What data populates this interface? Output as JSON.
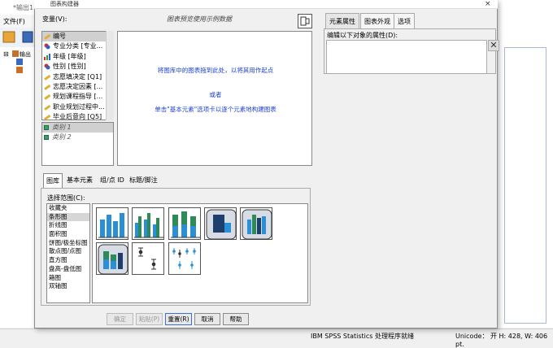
{
  "background": {
    "window_title": "*输出1",
    "menu_file": "文件(F)",
    "status_text": "IBM SPSS Statistics 处理程序就绪",
    "status_right": "Unicode： 开  H: 428, W: 406 pt."
  },
  "dialog": {
    "title": "图表构建器",
    "close_glyph": "×",
    "variables_label": "变量(V):",
    "preview_hint": "图表预览使用示例数据",
    "variables": [
      {
        "label": "编号",
        "icon": "scale-ruler-icon"
      },
      {
        "label": "专业分类 [专业...",
        "icon": "nominal-icon"
      },
      {
        "label": "年级 [年级]",
        "icon": "ordinal-bar-icon"
      },
      {
        "label": "性别 [性别]",
        "icon": "nominal-icon"
      },
      {
        "label": "志愿填决定 [Q1]",
        "icon": "scale-ruler-icon"
      },
      {
        "label": "志愿决定因素 [...",
        "icon": "scale-ruler-icon"
      },
      {
        "label": "规划课程指导 [...",
        "icon": "scale-ruler-icon"
      },
      {
        "label": "职业规划过程中...",
        "icon": "scale-ruler-icon"
      },
      {
        "label": "毕业后意向 [Q5]",
        "icon": "scale-ruler-icon"
      }
    ],
    "categories": [
      "类别 1",
      "类别 2"
    ],
    "canvas": {
      "line1": "将图库中的图表拖到此处，以将其用作起点",
      "or": "或者",
      "line2": "单击\"基本元素\"选项卡以逐个元素地构建图表"
    },
    "right_panel": {
      "tabs": [
        "元素属性",
        "图表外观",
        "选项"
      ],
      "edit_label": "编辑以下对象的属性(D):",
      "delete_glyph": "✕"
    },
    "gallery": {
      "tabs": [
        "图库",
        "基本元素",
        "组/点 ID",
        "标题/脚注"
      ],
      "choose_label": "选择范围(C):",
      "types": [
        "收藏夹",
        "条形图",
        "折线图",
        "面积图",
        "饼图/极坐标图",
        "散点图/点图",
        "直方图",
        "盘高-盘低图",
        "箱图",
        "双轴图"
      ],
      "selected_type": "条形图",
      "thumbnails": [
        "simple-bar-icon",
        "clustered-bar-icon",
        "stacked-bar-icon",
        "3d-bar-icon",
        "3d-clustered-bar-icon",
        "3d-stacked-bar-icon",
        "error-bar-icon",
        "clustered-error-bar-icon"
      ]
    },
    "buttons": {
      "ok": "确定",
      "paste": "粘贴(P)",
      "reset": "重置(R)",
      "cancel": "取消",
      "help": "帮助"
    }
  },
  "colors": {
    "accent_blue": "#1c3fd8",
    "bar_blue": "#2a8fd6",
    "bar_green": "#2e8b57",
    "bar_dark": "#1e3f6e"
  }
}
